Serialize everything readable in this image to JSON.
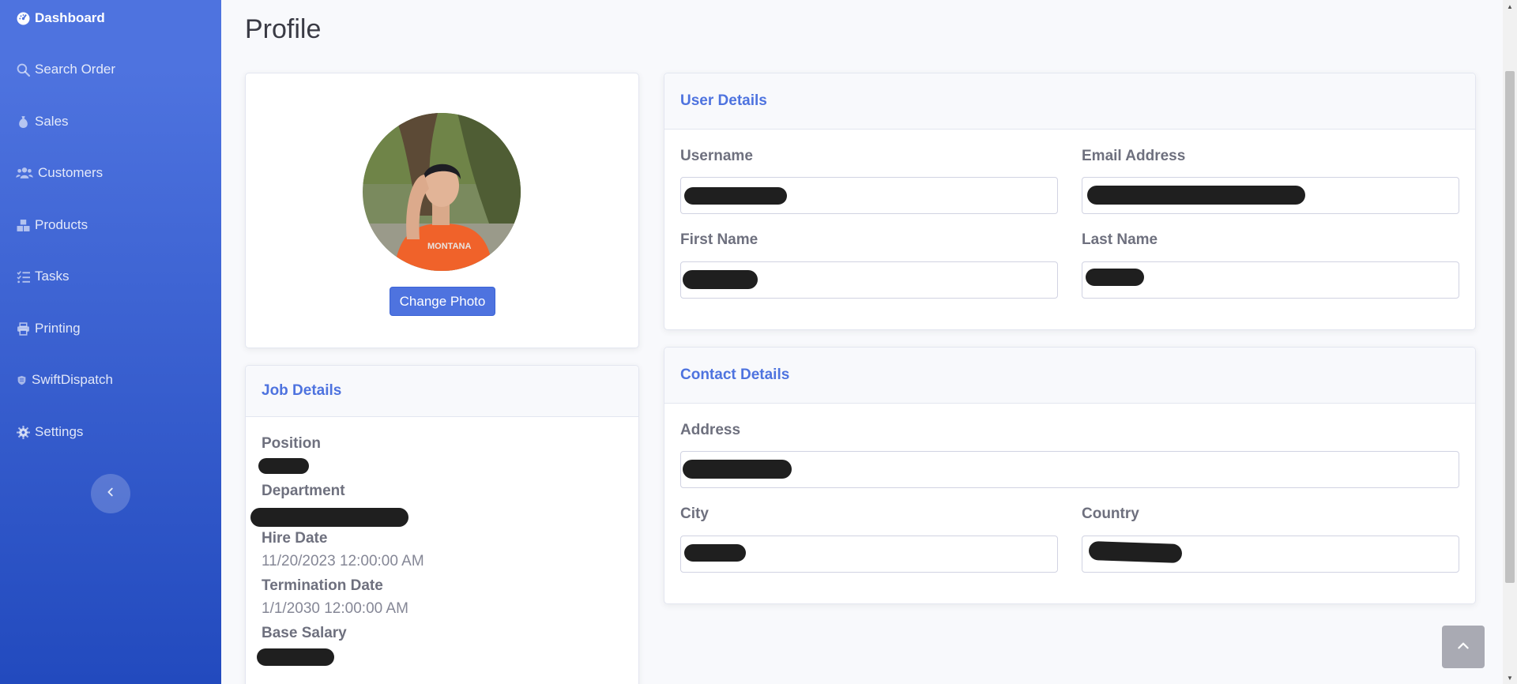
{
  "sidebar": {
    "items": [
      {
        "label": "Dashboard",
        "icon": "dashboard-icon"
      },
      {
        "label": "Search Order",
        "icon": "search-icon"
      },
      {
        "label": "Sales",
        "icon": "money-bag-icon"
      },
      {
        "label": "Customers",
        "icon": "users-icon"
      },
      {
        "label": "Products",
        "icon": "boxes-icon"
      },
      {
        "label": "Tasks",
        "icon": "list-check-icon"
      },
      {
        "label": "Printing",
        "icon": "printer-icon"
      },
      {
        "label": "SwiftDispatch",
        "icon": "shield-icon"
      },
      {
        "label": "Settings",
        "icon": "gear-icon"
      }
    ],
    "toggle_icon": "chevron-left-icon"
  },
  "page": {
    "title": "Profile"
  },
  "photo_card": {
    "button_label": "Change Photo",
    "avatar": "profile-photo"
  },
  "job_details": {
    "title": "Job Details",
    "position_label": "Position",
    "department_label": "Department",
    "hire_date_label": "Hire Date",
    "hire_date_value": "11/20/2023 12:00:00 AM",
    "termination_date_label": "Termination Date",
    "termination_date_value": "1/1/2030 12:00:00 AM",
    "base_salary_label": "Base Salary"
  },
  "user_details": {
    "title": "User Details",
    "username_label": "Username",
    "email_label": "Email Address",
    "first_name_label": "First Name",
    "last_name_label": "Last Name"
  },
  "contact_details": {
    "title": "Contact Details",
    "address_label": "Address",
    "city_label": "City",
    "country_label": "Country"
  },
  "colors": {
    "primary": "#4e73df",
    "sidebar_dark": "#224abe",
    "redaction": "#1f1f1f"
  }
}
